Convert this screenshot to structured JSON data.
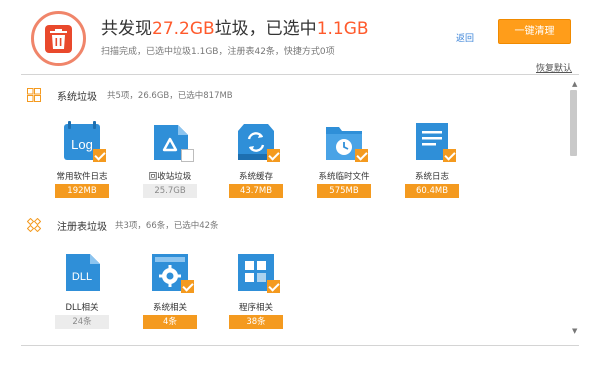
{
  "header": {
    "title_prefix": "共发现",
    "title_total": "27.2GB",
    "title_middle": "垃圾，已选中",
    "title_selected": "1.1GB",
    "subtitle": "扫描完成，已选中垃圾1.1GB，注册表42条，快捷方式0项",
    "back_link": "返回",
    "clean_button": "一键清理",
    "restore_link": "恢复默认"
  },
  "sections": [
    {
      "name": "系统垃圾",
      "info": "共5项，26.6GB，已选中817MB",
      "items": [
        {
          "label": "常用软件日志",
          "size": "192MB",
          "checked": true,
          "icon": "log-file-icon"
        },
        {
          "label": "回收站垃圾",
          "size": "25.7GB",
          "checked": false,
          "icon": "recycle-bin-icon"
        },
        {
          "label": "系统缓存",
          "size": "43.7MB",
          "checked": true,
          "icon": "system-cache-icon"
        },
        {
          "label": "系统临时文件",
          "size": "575MB",
          "checked": true,
          "icon": "temp-folder-icon"
        },
        {
          "label": "系统日志",
          "size": "60.4MB",
          "checked": true,
          "icon": "system-log-icon"
        }
      ]
    },
    {
      "name": "注册表垃圾",
      "info": "共3项，66条，已选中42条",
      "items": [
        {
          "label": "DLL相关",
          "size": "24条",
          "checked": false,
          "icon": "dll-file-icon"
        },
        {
          "label": "系统相关",
          "size": "4条",
          "checked": true,
          "icon": "gear-window-icon"
        },
        {
          "label": "程序相关",
          "size": "38条",
          "checked": true,
          "icon": "app-grid-icon"
        }
      ]
    }
  ],
  "colors": {
    "accent": "#f49a1f",
    "highlight": "#ff5a2c",
    "link": "#3a83d8",
    "icon_blue": "#2f8fd8"
  }
}
